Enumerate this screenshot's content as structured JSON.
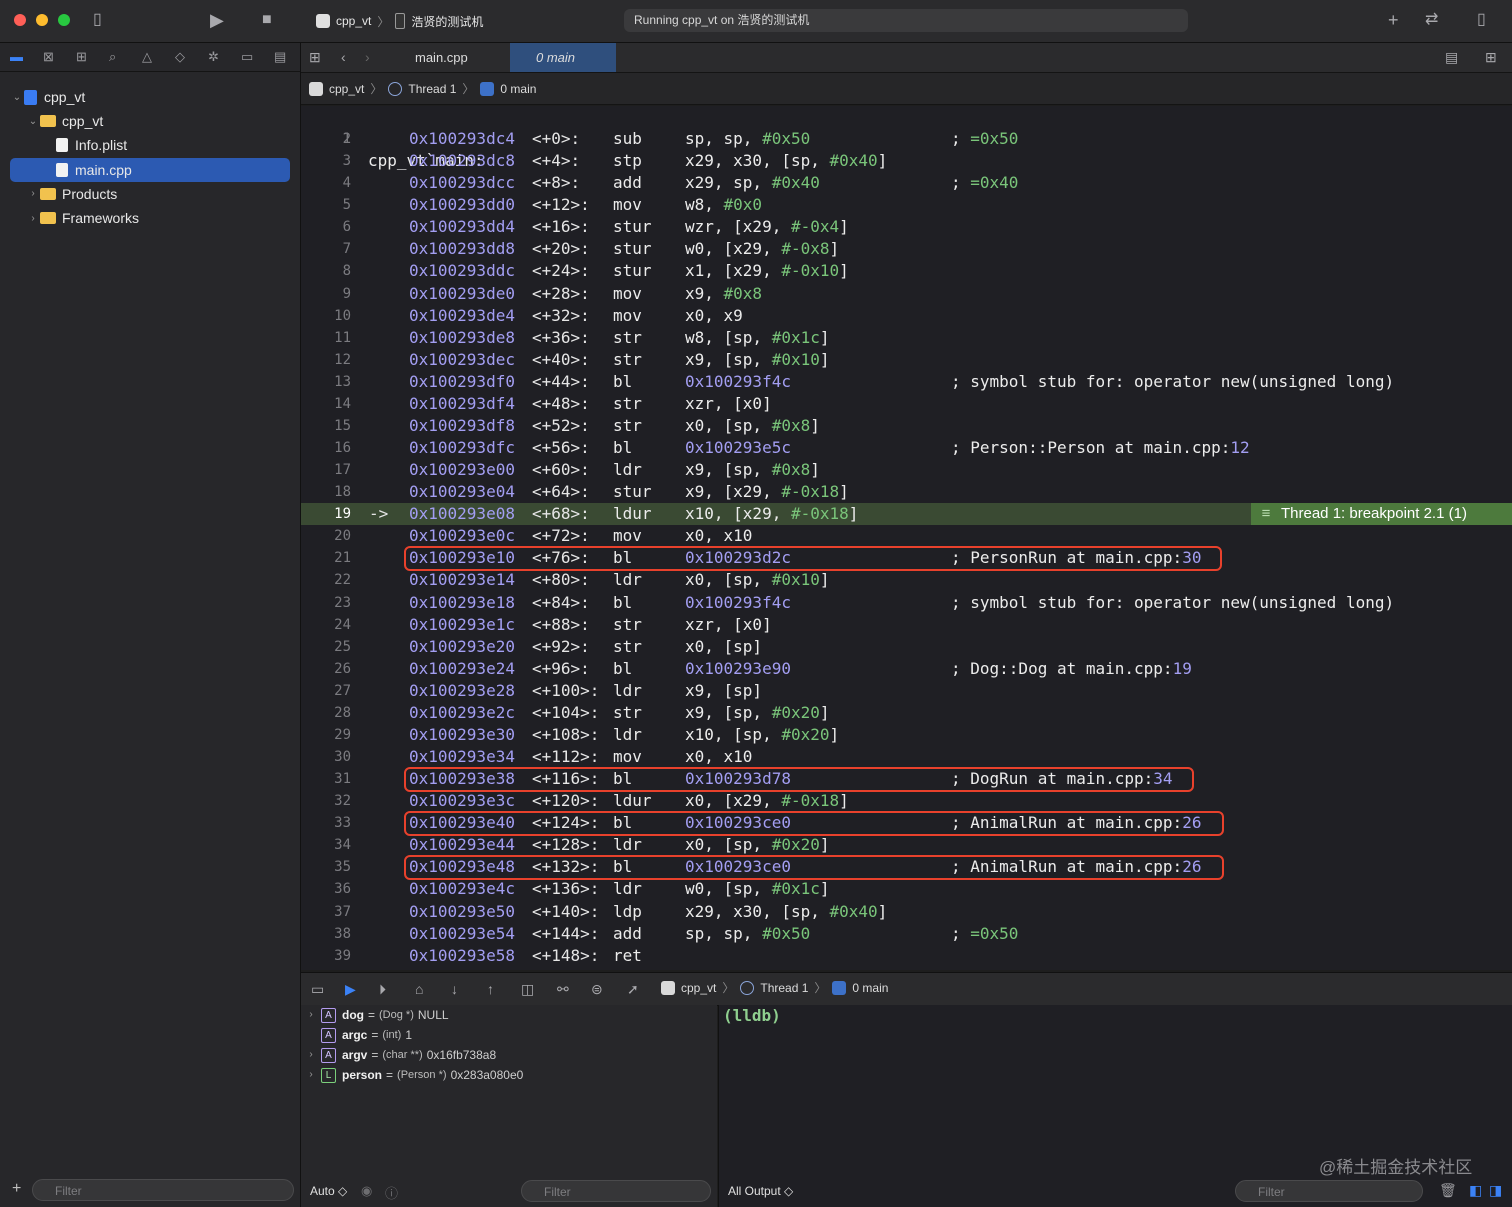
{
  "window": {
    "scheme_target": "cpp_vt",
    "device": "浩贤的测试机",
    "status": "Running cpp_vt on 浩贤的测试机"
  },
  "navigator": {
    "tree": [
      {
        "label": "cpp_vt",
        "kind": "project",
        "indent": 0,
        "chevron": "down"
      },
      {
        "label": "cpp_vt",
        "kind": "folder",
        "indent": 1,
        "chevron": "down"
      },
      {
        "label": "Info.plist",
        "kind": "file",
        "indent": 2,
        "chevron": ""
      },
      {
        "label": "main.cpp",
        "kind": "file",
        "indent": 2,
        "chevron": "",
        "selected": true
      },
      {
        "label": "Products",
        "kind": "folder",
        "indent": 1,
        "chevron": "right"
      },
      {
        "label": "Frameworks",
        "kind": "folder",
        "indent": 1,
        "chevron": "right"
      }
    ],
    "filter_placeholder": "Filter"
  },
  "tabs": [
    {
      "label": "main.cpp",
      "active": false
    },
    {
      "label": "0 main",
      "active": true
    }
  ],
  "jumpbar": {
    "project": "cpp_vt",
    "thread": "Thread 1",
    "frame": "0 main"
  },
  "code": {
    "header": "cpp_vt`main:",
    "current_line": 19,
    "breakpoint_label": "Thread 1: breakpoint 2.1 (1)",
    "highlighted_lines": [
      21,
      31,
      33,
      35
    ],
    "lines": [
      {
        "n": 2,
        "addr": "0x100293dc4",
        "off": "<+0>:",
        "op": "sub",
        "args": "sp, sp, #0x50",
        "cmt": "; =0x50"
      },
      {
        "n": 3,
        "addr": "0x100293dc8",
        "off": "<+4>:",
        "op": "stp",
        "args": "x29, x30, [sp, #0x40]",
        "cmt": ""
      },
      {
        "n": 4,
        "addr": "0x100293dcc",
        "off": "<+8>:",
        "op": "add",
        "args": "x29, sp, #0x40",
        "cmt": "; =0x40"
      },
      {
        "n": 5,
        "addr": "0x100293dd0",
        "off": "<+12>:",
        "op": "mov",
        "args": "w8, #0x0",
        "cmt": ""
      },
      {
        "n": 6,
        "addr": "0x100293dd4",
        "off": "<+16>:",
        "op": "stur",
        "args": "wzr, [x29, #-0x4]",
        "cmt": ""
      },
      {
        "n": 7,
        "addr": "0x100293dd8",
        "off": "<+20>:",
        "op": "stur",
        "args": "w0, [x29, #-0x8]",
        "cmt": ""
      },
      {
        "n": 8,
        "addr": "0x100293ddc",
        "off": "<+24>:",
        "op": "stur",
        "args": "x1, [x29, #-0x10]",
        "cmt": ""
      },
      {
        "n": 9,
        "addr": "0x100293de0",
        "off": "<+28>:",
        "op": "mov",
        "args": "x9, #0x8",
        "cmt": ""
      },
      {
        "n": 10,
        "addr": "0x100293de4",
        "off": "<+32>:",
        "op": "mov",
        "args": "x0, x9",
        "cmt": ""
      },
      {
        "n": 11,
        "addr": "0x100293de8",
        "off": "<+36>:",
        "op": "str",
        "args": "w8, [sp, #0x1c]",
        "cmt": ""
      },
      {
        "n": 12,
        "addr": "0x100293dec",
        "off": "<+40>:",
        "op": "str",
        "args": "x9, [sp, #0x10]",
        "cmt": ""
      },
      {
        "n": 13,
        "addr": "0x100293df0",
        "off": "<+44>:",
        "op": "bl",
        "args": "0x100293f4c",
        "cmt": "; symbol stub for: operator new(unsigned long)"
      },
      {
        "n": 14,
        "addr": "0x100293df4",
        "off": "<+48>:",
        "op": "str",
        "args": "xzr, [x0]",
        "cmt": ""
      },
      {
        "n": 15,
        "addr": "0x100293df8",
        "off": "<+52>:",
        "op": "str",
        "args": "x0, [sp, #0x8]",
        "cmt": ""
      },
      {
        "n": 16,
        "addr": "0x100293dfc",
        "off": "<+56>:",
        "op": "bl",
        "args": "0x100293e5c",
        "cmt": "; Person::Person at main.cpp:12"
      },
      {
        "n": 17,
        "addr": "0x100293e00",
        "off": "<+60>:",
        "op": "ldr",
        "args": "x9, [sp, #0x8]",
        "cmt": ""
      },
      {
        "n": 18,
        "addr": "0x100293e04",
        "off": "<+64>:",
        "op": "stur",
        "args": "x9, [x29, #-0x18]",
        "cmt": ""
      },
      {
        "n": 19,
        "addr": "0x100293e08",
        "off": "<+68>:",
        "op": "ldur",
        "args": "x10, [x29, #-0x18]",
        "cmt": ""
      },
      {
        "n": 20,
        "addr": "0x100293e0c",
        "off": "<+72>:",
        "op": "mov",
        "args": "x0, x10",
        "cmt": ""
      },
      {
        "n": 21,
        "addr": "0x100293e10",
        "off": "<+76>:",
        "op": "bl",
        "args": "0x100293d2c",
        "cmt": "; PersonRun at main.cpp:30"
      },
      {
        "n": 22,
        "addr": "0x100293e14",
        "off": "<+80>:",
        "op": "ldr",
        "args": "x0, [sp, #0x10]",
        "cmt": ""
      },
      {
        "n": 23,
        "addr": "0x100293e18",
        "off": "<+84>:",
        "op": "bl",
        "args": "0x100293f4c",
        "cmt": "; symbol stub for: operator new(unsigned long)"
      },
      {
        "n": 24,
        "addr": "0x100293e1c",
        "off": "<+88>:",
        "op": "str",
        "args": "xzr, [x0]",
        "cmt": ""
      },
      {
        "n": 25,
        "addr": "0x100293e20",
        "off": "<+92>:",
        "op": "str",
        "args": "x0, [sp]",
        "cmt": ""
      },
      {
        "n": 26,
        "addr": "0x100293e24",
        "off": "<+96>:",
        "op": "bl",
        "args": "0x100293e90",
        "cmt": "; Dog::Dog at main.cpp:19"
      },
      {
        "n": 27,
        "addr": "0x100293e28",
        "off": "<+100>:",
        "op": "ldr",
        "args": "x9, [sp]",
        "cmt": ""
      },
      {
        "n": 28,
        "addr": "0x100293e2c",
        "off": "<+104>:",
        "op": "str",
        "args": "x9, [sp, #0x20]",
        "cmt": ""
      },
      {
        "n": 29,
        "addr": "0x100293e30",
        "off": "<+108>:",
        "op": "ldr",
        "args": "x10, [sp, #0x20]",
        "cmt": ""
      },
      {
        "n": 30,
        "addr": "0x100293e34",
        "off": "<+112>:",
        "op": "mov",
        "args": "x0, x10",
        "cmt": ""
      },
      {
        "n": 31,
        "addr": "0x100293e38",
        "off": "<+116>:",
        "op": "bl",
        "args": "0x100293d78",
        "cmt": "; DogRun at main.cpp:34"
      },
      {
        "n": 32,
        "addr": "0x100293e3c",
        "off": "<+120>:",
        "op": "ldur",
        "args": "x0, [x29, #-0x18]",
        "cmt": ""
      },
      {
        "n": 33,
        "addr": "0x100293e40",
        "off": "<+124>:",
        "op": "bl",
        "args": "0x100293ce0",
        "cmt": "; AnimalRun at main.cpp:26"
      },
      {
        "n": 34,
        "addr": "0x100293e44",
        "off": "<+128>:",
        "op": "ldr",
        "args": "x0, [sp, #0x20]",
        "cmt": ""
      },
      {
        "n": 35,
        "addr": "0x100293e48",
        "off": "<+132>:",
        "op": "bl",
        "args": "0x100293ce0",
        "cmt": "; AnimalRun at main.cpp:26"
      },
      {
        "n": 36,
        "addr": "0x100293e4c",
        "off": "<+136>:",
        "op": "ldr",
        "args": "w0, [sp, #0x1c]",
        "cmt": ""
      },
      {
        "n": 37,
        "addr": "0x100293e50",
        "off": "<+140>:",
        "op": "ldp",
        "args": "x29, x30, [sp, #0x40]",
        "cmt": ""
      },
      {
        "n": 38,
        "addr": "0x100293e54",
        "off": "<+144>:",
        "op": "add",
        "args": "sp, sp, #0x50",
        "cmt": "; =0x50"
      },
      {
        "n": 39,
        "addr": "0x100293e58",
        "off": "<+148>:",
        "op": "ret",
        "args": "",
        "cmt": ""
      }
    ]
  },
  "debug": {
    "jumpbar": {
      "project": "cpp_vt",
      "thread": "Thread 1",
      "frame": "0 main"
    },
    "variables": [
      {
        "badge": "A",
        "name": "dog",
        "type": "(Dog *)",
        "value": "NULL",
        "expandable": true
      },
      {
        "badge": "A",
        "name": "argc",
        "type": "(int)",
        "value": "1",
        "expandable": false
      },
      {
        "badge": "A",
        "name": "argv",
        "type": "(char **)",
        "value": "0x16fb738a8",
        "expandable": true
      },
      {
        "badge": "L",
        "name": "person",
        "type": "(Person *)",
        "value": "0x283a080e0",
        "expandable": true
      }
    ],
    "console_prompt": "(lldb)",
    "vars_mode": "Auto ◇",
    "output_mode": "All Output ◇",
    "filter_placeholder": "Filter",
    "watermark": "@稀土掘金技术社区"
  },
  "colors": {
    "address": "#a39ef2",
    "immediate": "#7ac57a",
    "current_line": "#3a4a33",
    "breakpoint": "#4d7a3d",
    "selection": "#2c5ab2",
    "annotation_box": "#e8412c"
  }
}
